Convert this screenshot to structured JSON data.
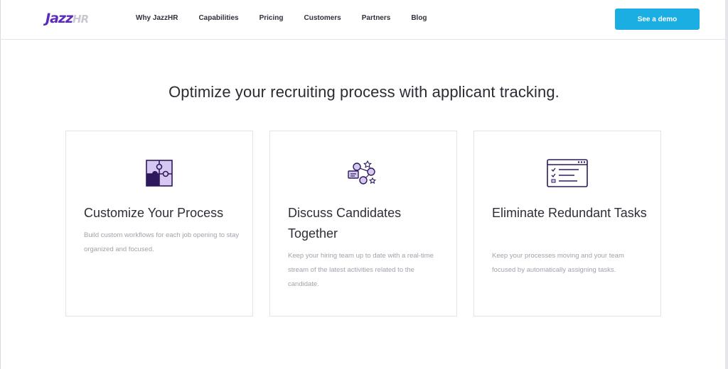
{
  "brand": {
    "logo_part1": "Jazz",
    "logo_part2": "HR"
  },
  "nav": {
    "items": [
      "Why JazzHR",
      "Capabilities",
      "Pricing",
      "Customers",
      "Partners",
      "Blog"
    ]
  },
  "cta": {
    "demo_label": "See a demo"
  },
  "main": {
    "headline": "Optimize your recruiting process with applicant tracking.",
    "cards": [
      {
        "icon": "puzzle-icon",
        "title": "Customize Your Process",
        "body": "Build custom workflows for each job opening to stay organized and focused."
      },
      {
        "icon": "team-chat-icon",
        "title": "Discuss Candidates Together",
        "body": "Keep your hiring team up to date with a real-time stream of the latest activities related to the candidate."
      },
      {
        "icon": "checklist-window-icon",
        "title": "Eliminate Redundant Tasks",
        "body": "Keep your processes moving and your team focused by automatically assigning tasks."
      }
    ]
  },
  "colors": {
    "brand_purple": "#5c2bb8",
    "cta_blue": "#1baee3",
    "icon_lavender": "#d6c8f0",
    "icon_dark": "#2d1a5c"
  }
}
